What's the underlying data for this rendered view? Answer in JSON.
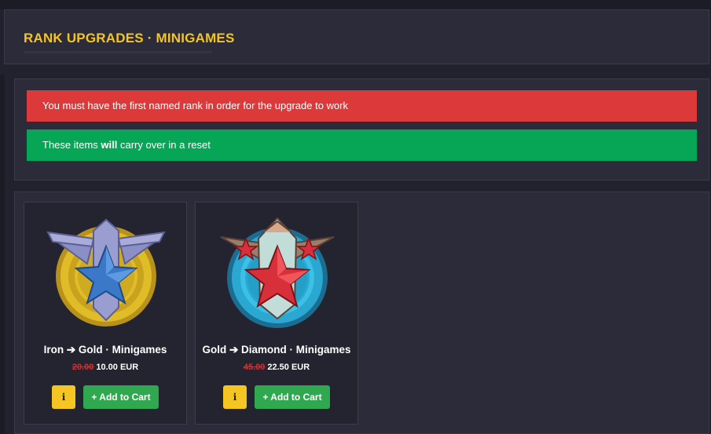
{
  "header": {
    "title": "RANK UPGRADES · MINIGAMES"
  },
  "notices": {
    "red": "You must have the first named rank in order for the upgrade to work",
    "green_before": "These items ",
    "green_bold": "will",
    "green_after": " carry over in a reset"
  },
  "products": [
    {
      "name": "Iron ➔ Gold · Minigames",
      "old_price": "20.00",
      "new_price": "10.00 EUR",
      "info_label": "i",
      "cart_label": "+ Add to Cart",
      "badge_icon": "iron-gold-rank-badge-icon",
      "colors": {
        "ring": "#d9b51e",
        "star": "#3b78c8",
        "wings": "#8b8fc6"
      }
    },
    {
      "name": "Gold ➔ Diamond · Minigames",
      "old_price": "45.00",
      "new_price": "22.50 EUR",
      "info_label": "i",
      "cart_label": "+ Add to Cart",
      "badge_icon": "gold-diamond-rank-badge-icon",
      "colors": {
        "ring": "#2aa8d2",
        "star": "#d8303a",
        "wings": "#9b7d6a"
      }
    }
  ],
  "colors": {
    "accent": "#f5c524",
    "alert_red": "#dc3a3a",
    "alert_green": "#07a556",
    "cart_green": "#2fa84f"
  }
}
